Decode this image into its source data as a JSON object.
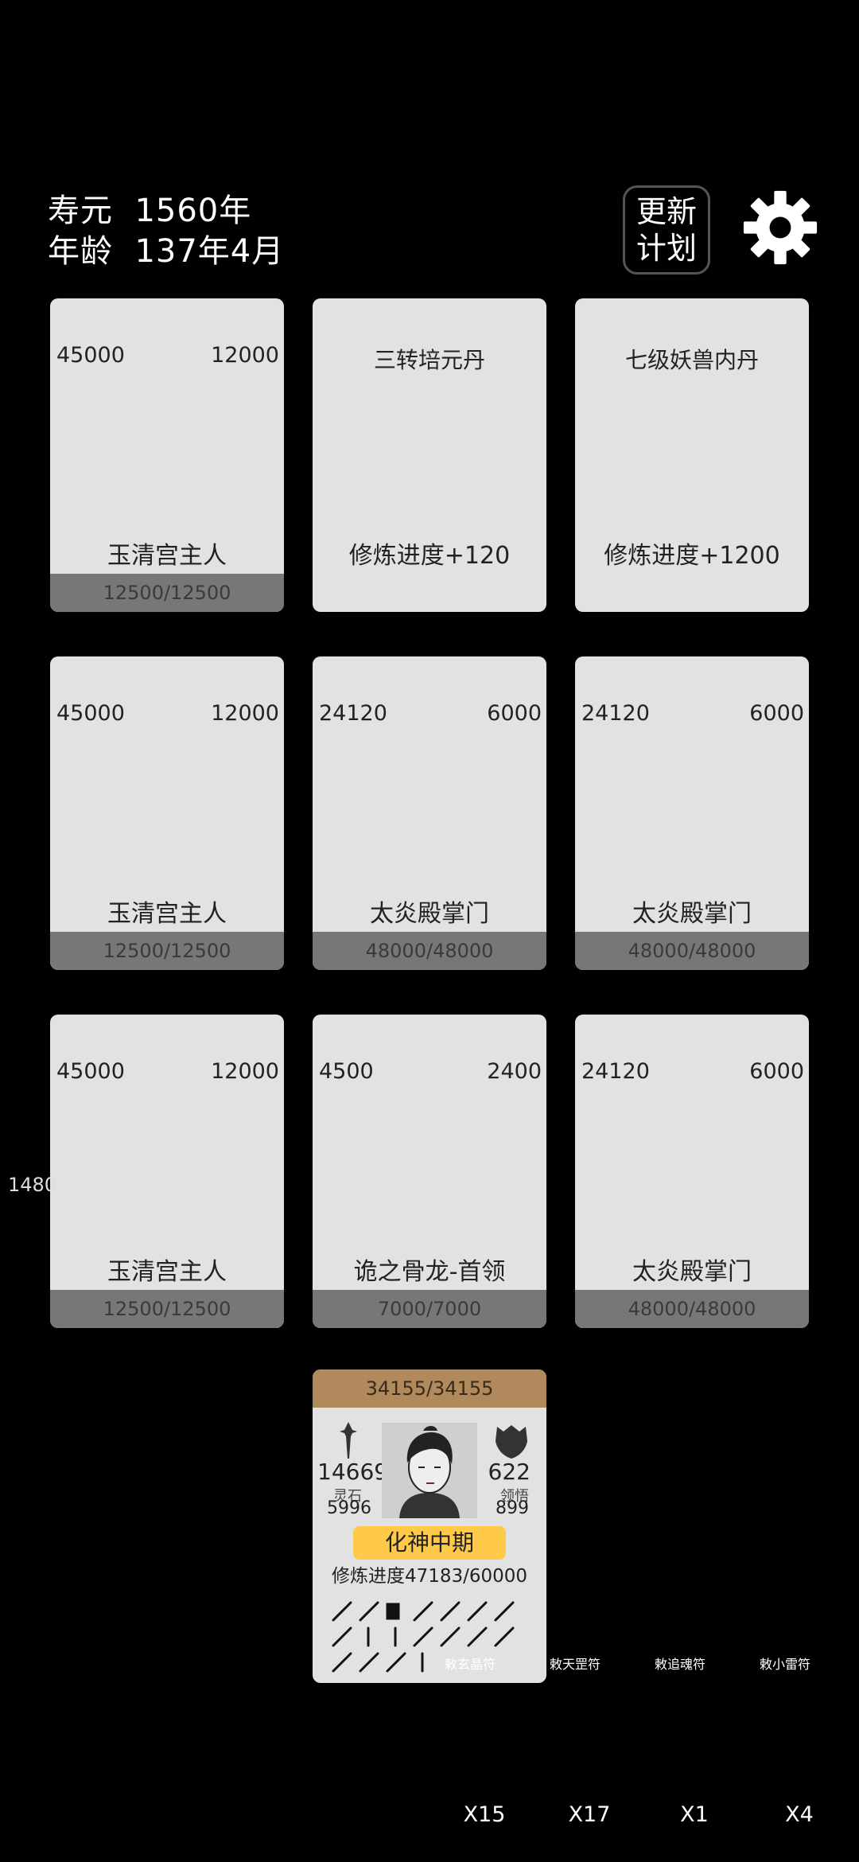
{
  "header": {
    "lifespan_label": "寿元",
    "lifespan_value": "1560年",
    "age_label": "年龄",
    "age_value": "137年4月",
    "plan_button_line1": "更新",
    "plan_button_line2": "计划"
  },
  "side_number": "1480",
  "cards": [
    {
      "type": "enemy",
      "attack": "45000",
      "defense": "12000",
      "name": "玉清宫主人",
      "hp": "12500/12500",
      "portrait": "robed-cultivator"
    },
    {
      "type": "item",
      "name": "三转培元丹",
      "effect": "修炼进度+120",
      "bg": "#a9a9a9",
      "orb": "#6cc4ee"
    },
    {
      "type": "item",
      "name": "七级妖兽内丹",
      "effect": "修炼进度+1200",
      "bg": "#aaa6cc",
      "orb": "#e2e22a"
    },
    {
      "type": "enemy",
      "attack": "45000",
      "defense": "12000",
      "name": "玉清宫主人",
      "hp": "12500/12500",
      "portrait": "robed-cultivator"
    },
    {
      "type": "enemy",
      "attack": "24120",
      "defense": "6000",
      "name": "太炎殿掌门",
      "hp": "48000/48000",
      "portrait": "flame-demon"
    },
    {
      "type": "enemy",
      "attack": "24120",
      "defense": "6000",
      "name": "太炎殿掌门",
      "hp": "48000/48000",
      "portrait": "flame-demon"
    },
    {
      "type": "enemy",
      "attack": "45000",
      "defense": "12000",
      "name": "玉清宫主人",
      "hp": "12500/12500",
      "portrait": "robed-cultivator"
    },
    {
      "type": "enemy",
      "attack": "4500",
      "defense": "2400",
      "name": "诡之骨龙-首领",
      "hp": "7000/7000",
      "portrait": "bone-dragon"
    },
    {
      "type": "enemy",
      "attack": "24120",
      "defense": "6000",
      "name": "太炎殿掌门",
      "hp": "48000/48000",
      "portrait": "flame-demon"
    }
  ],
  "player": {
    "hp": "34155/34155",
    "attack": "14669",
    "defense": "622",
    "spirit_stone_label": "灵石",
    "spirit_stone_value": "5996",
    "insight_label": "领悟",
    "insight_value": "899",
    "realm": "化神中期",
    "progress_label": "修炼进度",
    "progress_value": "47183/60000",
    "progress_fraction": 0.786
  },
  "talismans": [
    {
      "name": "玄晶符",
      "count": "X15",
      "color": "#e85a5a"
    },
    {
      "name": "天罡符",
      "count": "X17",
      "color": "#e85a5a"
    },
    {
      "name": "追魂符",
      "count": "X1",
      "color": "#e8d870"
    },
    {
      "name": "小雷符",
      "count": "X4",
      "color": "#e8d870"
    }
  ],
  "colors": {
    "card_bg": "#e2e2e2",
    "hp_bar": "#777777",
    "player_hp_bar": "#b08a5c",
    "realm_badge": "#ffc94a"
  }
}
